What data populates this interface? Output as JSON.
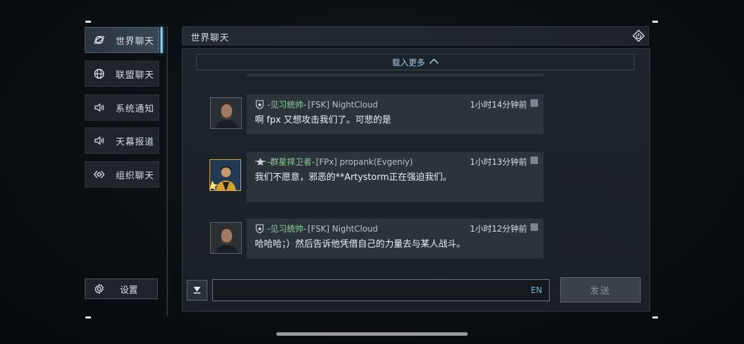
{
  "sidebar": {
    "items": [
      {
        "label": "世界聊天",
        "icon": "planet-icon",
        "active": true
      },
      {
        "label": "联盟聊天",
        "icon": "globe-icon",
        "active": false
      },
      {
        "label": "系统通知",
        "icon": "speaker-icon",
        "active": false
      },
      {
        "label": "天幕报道",
        "icon": "speaker-icon",
        "active": false
      },
      {
        "label": "组织聊天",
        "icon": "organization-icon",
        "active": false
      }
    ],
    "settings_label": "设置"
  },
  "header": {
    "title": "世界聊天"
  },
  "chat": {
    "load_more": "载入更多",
    "messages": [
      {
        "rank": "-见习统帅-",
        "tag": "[FSK] NightCloud",
        "time": "1小时14分钟前",
        "text": "啊 fpx 又想攻击我们了。可悲的是"
      },
      {
        "rank": "-群星捍卫者-",
        "tag": "[FPx] propank(Evgeniy)",
        "time": "1小时13分钟前",
        "text": "我们不愿意，邪恶的**Artystorm正在强迫我们。"
      },
      {
        "rank": "-见习统帅-",
        "tag": "[FSK] NightCloud",
        "time": "1小时12分钟前",
        "text": "哈哈哈；）然后告诉他凭借自己的力量去与某人战斗。"
      }
    ]
  },
  "input": {
    "value": "",
    "lang": "EN",
    "send_label": "发送"
  },
  "colors": {
    "accent": "#7fd3f0",
    "rank_green": "#8fd09a"
  }
}
